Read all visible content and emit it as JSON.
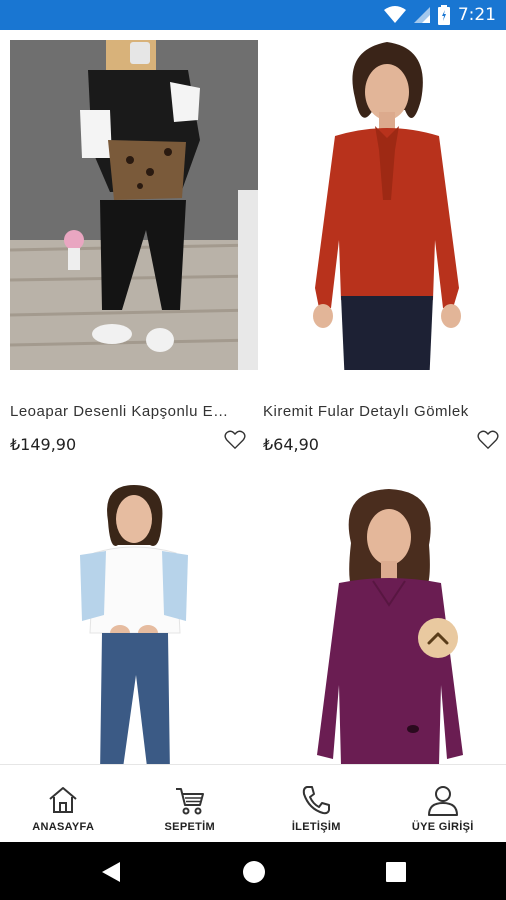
{
  "status_bar": {
    "time": "7:21",
    "icons": [
      "wifi-icon",
      "signal-icon",
      "battery-icon"
    ],
    "color": "#1976d2"
  },
  "products": [
    {
      "name": "Leoapar Desenli Kapşonlu Eşofman Takımı",
      "price": "₺149,90",
      "image": "woman-in-black-leopard-tracksuit"
    },
    {
      "name": "Kiremit Fular Detaylı Gömlek",
      "price": "₺64,90",
      "image": "woman-in-red-bow-blouse"
    },
    {
      "name": "",
      "price": "",
      "image": "woman-in-white-blouse-blue-sleeves"
    },
    {
      "name": "",
      "price": "",
      "image": "woman-in-purple-sweater"
    }
  ],
  "bottom_nav": {
    "items": [
      {
        "label": "ANASAYFA",
        "icon": "home-icon"
      },
      {
        "label": "SEPETİM",
        "icon": "cart-icon"
      },
      {
        "label": "İLETİŞİM",
        "icon": "phone-icon"
      },
      {
        "label": "ÜYE GİRİŞİ",
        "icon": "user-icon"
      }
    ]
  },
  "scroll_top": {
    "icon": "chevron-up-icon",
    "color": "#e9c9a0"
  },
  "system_nav": {
    "buttons": [
      "back-icon",
      "home-circle-icon",
      "recents-icon"
    ]
  }
}
